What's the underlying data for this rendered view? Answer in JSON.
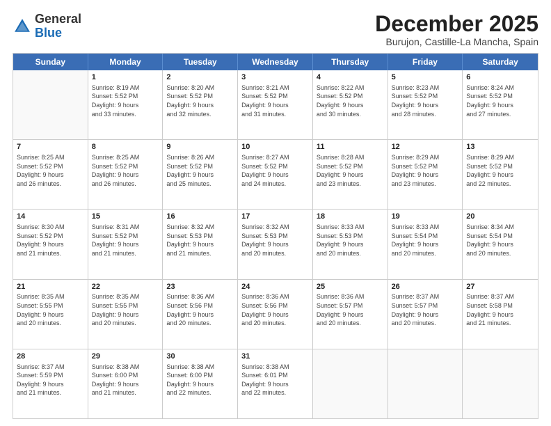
{
  "header": {
    "logo_general": "General",
    "logo_blue": "Blue",
    "title": "December 2025",
    "location": "Burujon, Castille-La Mancha, Spain"
  },
  "weekdays": [
    "Sunday",
    "Monday",
    "Tuesday",
    "Wednesday",
    "Thursday",
    "Friday",
    "Saturday"
  ],
  "rows": [
    [
      {
        "day": "",
        "info": ""
      },
      {
        "day": "1",
        "info": "Sunrise: 8:19 AM\nSunset: 5:52 PM\nDaylight: 9 hours\nand 33 minutes."
      },
      {
        "day": "2",
        "info": "Sunrise: 8:20 AM\nSunset: 5:52 PM\nDaylight: 9 hours\nand 32 minutes."
      },
      {
        "day": "3",
        "info": "Sunrise: 8:21 AM\nSunset: 5:52 PM\nDaylight: 9 hours\nand 31 minutes."
      },
      {
        "day": "4",
        "info": "Sunrise: 8:22 AM\nSunset: 5:52 PM\nDaylight: 9 hours\nand 30 minutes."
      },
      {
        "day": "5",
        "info": "Sunrise: 8:23 AM\nSunset: 5:52 PM\nDaylight: 9 hours\nand 28 minutes."
      },
      {
        "day": "6",
        "info": "Sunrise: 8:24 AM\nSunset: 5:52 PM\nDaylight: 9 hours\nand 27 minutes."
      }
    ],
    [
      {
        "day": "7",
        "info": "Sunrise: 8:25 AM\nSunset: 5:52 PM\nDaylight: 9 hours\nand 26 minutes."
      },
      {
        "day": "8",
        "info": "Sunrise: 8:25 AM\nSunset: 5:52 PM\nDaylight: 9 hours\nand 26 minutes."
      },
      {
        "day": "9",
        "info": "Sunrise: 8:26 AM\nSunset: 5:52 PM\nDaylight: 9 hours\nand 25 minutes."
      },
      {
        "day": "10",
        "info": "Sunrise: 8:27 AM\nSunset: 5:52 PM\nDaylight: 9 hours\nand 24 minutes."
      },
      {
        "day": "11",
        "info": "Sunrise: 8:28 AM\nSunset: 5:52 PM\nDaylight: 9 hours\nand 23 minutes."
      },
      {
        "day": "12",
        "info": "Sunrise: 8:29 AM\nSunset: 5:52 PM\nDaylight: 9 hours\nand 23 minutes."
      },
      {
        "day": "13",
        "info": "Sunrise: 8:29 AM\nSunset: 5:52 PM\nDaylight: 9 hours\nand 22 minutes."
      }
    ],
    [
      {
        "day": "14",
        "info": "Sunrise: 8:30 AM\nSunset: 5:52 PM\nDaylight: 9 hours\nand 21 minutes."
      },
      {
        "day": "15",
        "info": "Sunrise: 8:31 AM\nSunset: 5:52 PM\nDaylight: 9 hours\nand 21 minutes."
      },
      {
        "day": "16",
        "info": "Sunrise: 8:32 AM\nSunset: 5:53 PM\nDaylight: 9 hours\nand 21 minutes."
      },
      {
        "day": "17",
        "info": "Sunrise: 8:32 AM\nSunset: 5:53 PM\nDaylight: 9 hours\nand 20 minutes."
      },
      {
        "day": "18",
        "info": "Sunrise: 8:33 AM\nSunset: 5:53 PM\nDaylight: 9 hours\nand 20 minutes."
      },
      {
        "day": "19",
        "info": "Sunrise: 8:33 AM\nSunset: 5:54 PM\nDaylight: 9 hours\nand 20 minutes."
      },
      {
        "day": "20",
        "info": "Sunrise: 8:34 AM\nSunset: 5:54 PM\nDaylight: 9 hours\nand 20 minutes."
      }
    ],
    [
      {
        "day": "21",
        "info": "Sunrise: 8:35 AM\nSunset: 5:55 PM\nDaylight: 9 hours\nand 20 minutes."
      },
      {
        "day": "22",
        "info": "Sunrise: 8:35 AM\nSunset: 5:55 PM\nDaylight: 9 hours\nand 20 minutes."
      },
      {
        "day": "23",
        "info": "Sunrise: 8:36 AM\nSunset: 5:56 PM\nDaylight: 9 hours\nand 20 minutes."
      },
      {
        "day": "24",
        "info": "Sunrise: 8:36 AM\nSunset: 5:56 PM\nDaylight: 9 hours\nand 20 minutes."
      },
      {
        "day": "25",
        "info": "Sunrise: 8:36 AM\nSunset: 5:57 PM\nDaylight: 9 hours\nand 20 minutes."
      },
      {
        "day": "26",
        "info": "Sunrise: 8:37 AM\nSunset: 5:57 PM\nDaylight: 9 hours\nand 20 minutes."
      },
      {
        "day": "27",
        "info": "Sunrise: 8:37 AM\nSunset: 5:58 PM\nDaylight: 9 hours\nand 21 minutes."
      }
    ],
    [
      {
        "day": "28",
        "info": "Sunrise: 8:37 AM\nSunset: 5:59 PM\nDaylight: 9 hours\nand 21 minutes."
      },
      {
        "day": "29",
        "info": "Sunrise: 8:38 AM\nSunset: 6:00 PM\nDaylight: 9 hours\nand 21 minutes."
      },
      {
        "day": "30",
        "info": "Sunrise: 8:38 AM\nSunset: 6:00 PM\nDaylight: 9 hours\nand 22 minutes."
      },
      {
        "day": "31",
        "info": "Sunrise: 8:38 AM\nSunset: 6:01 PM\nDaylight: 9 hours\nand 22 minutes."
      },
      {
        "day": "",
        "info": ""
      },
      {
        "day": "",
        "info": ""
      },
      {
        "day": "",
        "info": ""
      }
    ]
  ]
}
